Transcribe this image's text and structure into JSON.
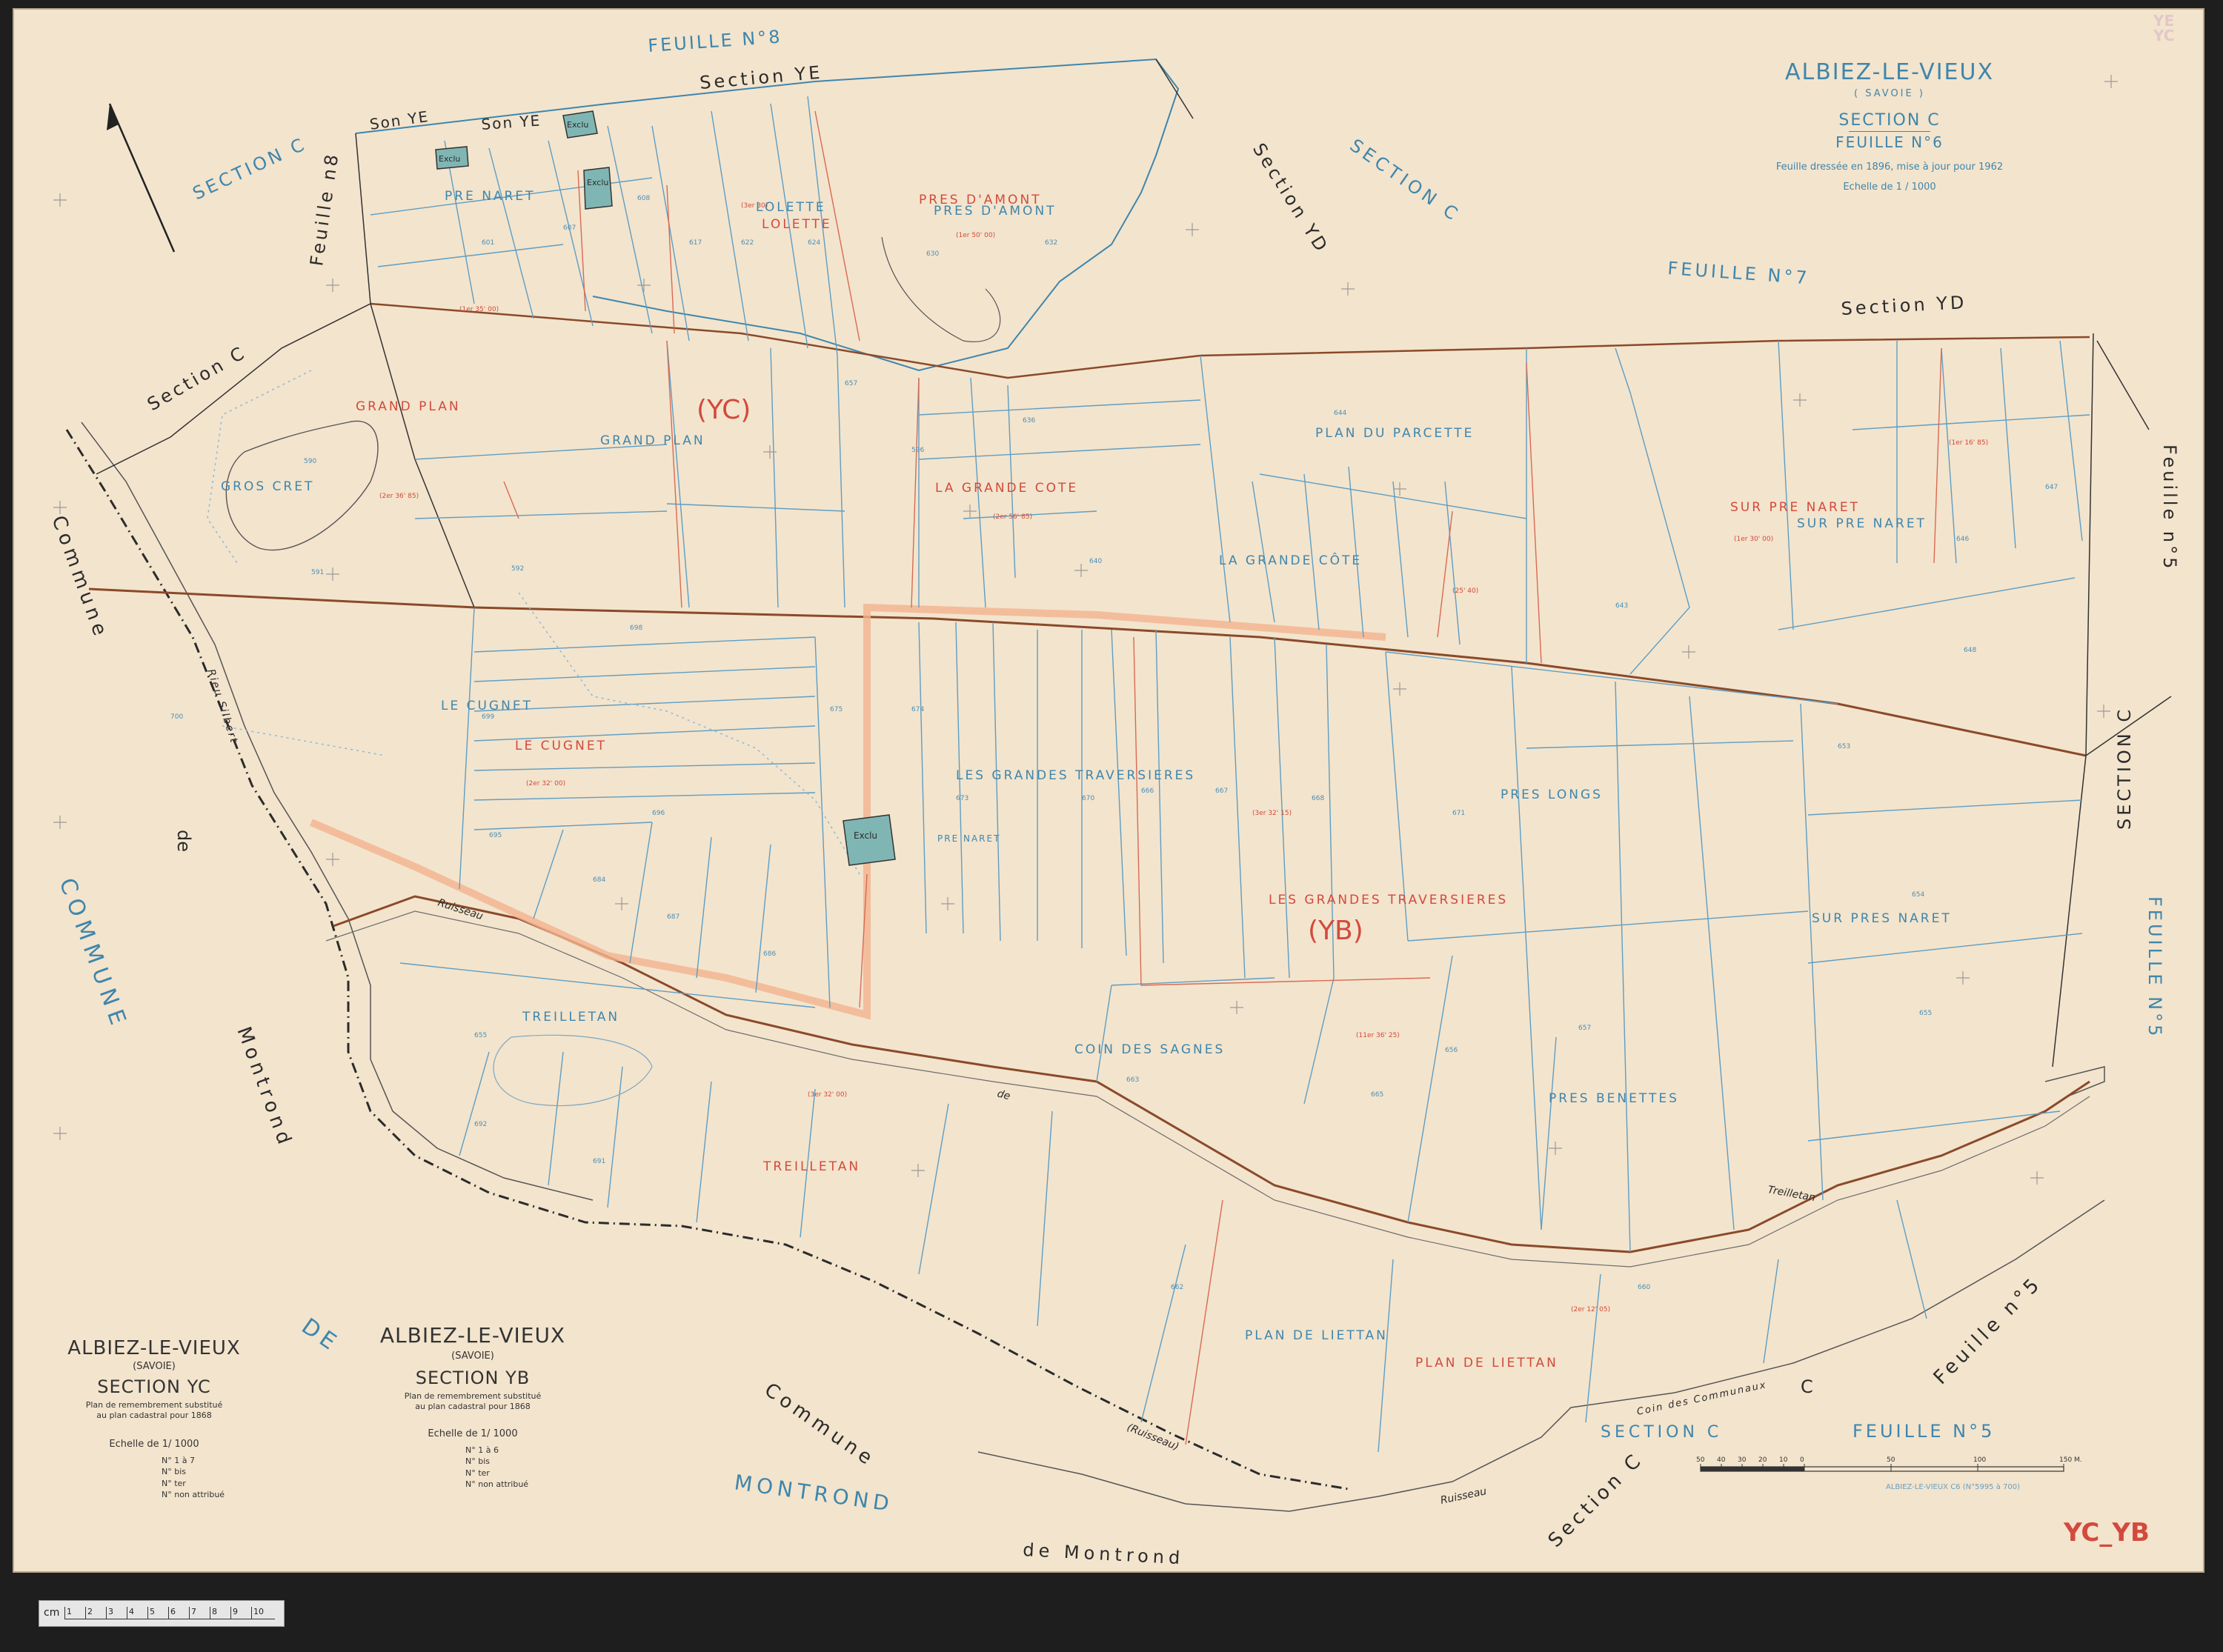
{
  "title": {
    "commune": "ALBIEZ-LE-VIEUX",
    "dept": "( SAVOIE )",
    "section": "SECTION C",
    "feuille": "FEUILLE N°6",
    "note": "Feuille dressée en 1896, mise à jour pour 1962",
    "echelle": "Echelle de 1 / 1000"
  },
  "cart_yc": {
    "commune": "ALBIEZ-LE-VIEUX",
    "dept": "(SAVOIE)",
    "section": "SECTION YC",
    "desc1": "Plan de remembrement substitué",
    "desc2": "au plan cadastral pour 1868",
    "echelle": "Echelle de 1/ 1000",
    "items": [
      "N° 1 à 7",
      "N° bis",
      "N° ter",
      "N° non attribué"
    ]
  },
  "cart_yb": {
    "commune": "ALBIEZ-LE-VIEUX",
    "dept": "(SAVOIE)",
    "section": "SECTION YB",
    "desc1": "Plan de remembrement substitué",
    "desc2": "au plan cadastral pour 1868",
    "echelle": "Echelle de 1/ 1000",
    "items": [
      "N° 1 à 6",
      "N° bis",
      "N° ter",
      "N° non attribué"
    ]
  },
  "neighbors": {
    "feuille8": "FEUILLE N°8",
    "section_ye": "Section YE",
    "section_c_feuille8": "SECTION C",
    "feuille_n8": "Feuille n8",
    "section_c_top": "SECTION C",
    "section_yd_top": "Section YD",
    "feuille7": "FEUILLE N°7",
    "section_yd": "Section YD",
    "feuille_n5_right": "Feuille n°5",
    "section_c_right": "SECTION C",
    "feuille_n5_right2": "FEUILLE N°5",
    "section_c_left": "Section C",
    "section_c_bottom": "SECTION C",
    "feuille_n5_bottom": "FEUILLE N°5",
    "feuille_n5_bottom2": "Feuille n°5",
    "section_c_bottom2": "Section C",
    "c_bottom": "C",
    "commune_left": "Commune",
    "commune_left_big": "COMMUNE",
    "de_montrond_left": "de",
    "montrond_left": "Montrond",
    "commune_bottom": "Commune",
    "de_bottom": "DE",
    "montrond_bottom": "MONTROND",
    "de_montrond_bottom": "de Montrond"
  },
  "places_blue": {
    "pre_naret_top": "PRE NARET",
    "lolette": "LOLETTE",
    "pres_amont": "PRES D'AMONT",
    "grand_plan": "GRAND PLAN",
    "gros_cret": "GROS CRET",
    "plan_parcette": "PLAN DU PARCETTE",
    "grande_cote": "LA GRANDE CÔTE",
    "sur_pre_naret": "SUR PRE NARET",
    "le_cugnet": "LE CUGNET",
    "grandes_traversieres": "LES GRANDES TRAVERSIERES",
    "pres_longs": "PRES LONGS",
    "pre_naret_small": "PRE NARET",
    "sur_pres_naret": "SUR PRES NARET",
    "treilletan": "TREILLETAN",
    "coin_sagnes": "COIN DES SAGNES",
    "pres_benettes": "PRES BENETTES",
    "plan_liettan": "PLAN DE LIETTAN",
    "son_ye_1": "Son YE",
    "son_ye_2": "Son YE"
  },
  "places_red": {
    "lolette": "LOLETTE",
    "pres_amont": "PRES D'AMONT",
    "grand_plan": "GRAND PLAN",
    "yc": "(YC)",
    "grande_cote": "LA GRANDE COTE",
    "sur_pre_naret": "SUR PRE NARET",
    "le_cugnet": "LE CUGNET",
    "grandes_traversieres": "LES GRANDES TRAVERSIERES",
    "yb": "(YB)",
    "treilletan": "TREILLETAN",
    "plan_liettan": "PLAN DE LIETTAN"
  },
  "water": {
    "rieu_silbert": "Rieu Silbert",
    "ruisseau_1": "Ruisseau",
    "ruisseau_2": "(Ruisseau)",
    "ruisseau_3": "Ruisseau",
    "de_treilletan": "de",
    "treilletan": "Treilletan",
    "coin_communaux": "Coin des Communaux"
  },
  "scale_bar": {
    "ticks": [
      "50",
      "40",
      "30",
      "20",
      "10",
      "0",
      "50",
      "100",
      "150 M."
    ],
    "ref": "ALBIEZ-LE-VIEUX C6 (N°5995 à 700)"
  },
  "corner_stamp": "YC_YB",
  "corner_tr": [
    "YE",
    "YC"
  ],
  "exclu": "Exclu",
  "ruler": {
    "label": "cm",
    "ticks": [
      "1",
      "2",
      "3",
      "4",
      "5",
      "6",
      "7",
      "8",
      "9",
      "10"
    ]
  },
  "colors": {
    "paper": "#f3e4cd",
    "blue": "#3e86ad",
    "red": "#d24a3c",
    "brown": "#8a4a2a",
    "stream": "#2b2b2b"
  }
}
